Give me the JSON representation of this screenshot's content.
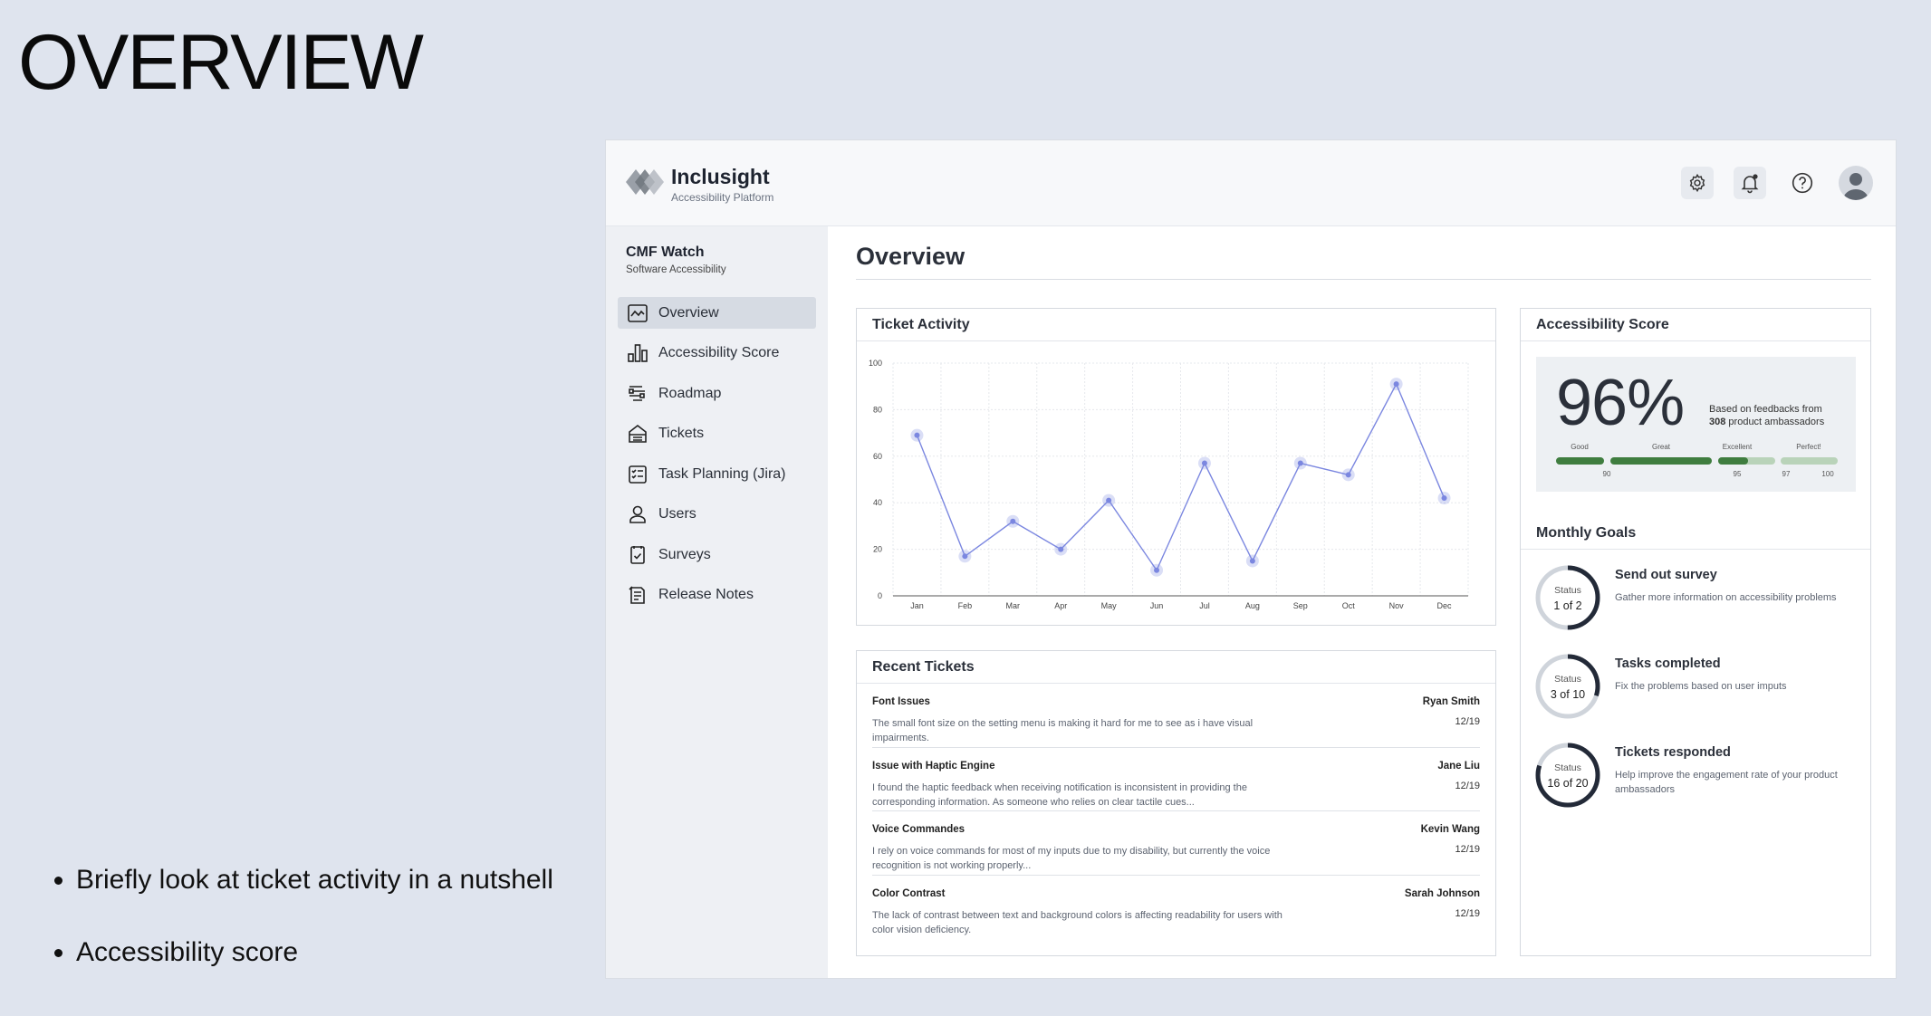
{
  "slide": {
    "title": "OVERVIEW",
    "bullets": [
      "Briefly look at ticket activity in a nutshell",
      "Accessibility score"
    ]
  },
  "app": {
    "brand": "Inclusight",
    "brand_sub": "Accessibility Platform",
    "top_icons": [
      "gear-icon",
      "bell-icon",
      "help-icon",
      "avatar-icon"
    ]
  },
  "sidebar": {
    "project_name": "CMF Watch",
    "project_sub": "Software Accessibility",
    "items": [
      {
        "label": "Overview",
        "icon": "chart-line-icon",
        "active": true
      },
      {
        "label": "Accessibility Score",
        "icon": "bar-chart-icon",
        "active": false
      },
      {
        "label": "Roadmap",
        "icon": "roadmap-icon",
        "active": false
      },
      {
        "label": "Tickets",
        "icon": "ticket-icon",
        "active": false
      },
      {
        "label": "Task Planning (Jira)",
        "icon": "checklist-icon",
        "active": false
      },
      {
        "label": "Users",
        "icon": "user-icon",
        "active": false
      },
      {
        "label": "Surveys",
        "icon": "survey-icon",
        "active": false
      },
      {
        "label": "Release Notes",
        "icon": "notes-icon",
        "active": false
      }
    ]
  },
  "main": {
    "page_title": "Overview",
    "ticket_activity_title": "Ticket Activity",
    "recent_tickets_title": "Recent Tickets",
    "accessibility_score_title": "Accessibility Score",
    "monthly_goals_title": "Monthly Goals"
  },
  "chart_data": {
    "type": "line",
    "categories": [
      "Jan",
      "Feb",
      "Mar",
      "Apr",
      "May",
      "Jun",
      "Jul",
      "Aug",
      "Sep",
      "Oct",
      "Nov",
      "Dec"
    ],
    "series": [
      {
        "values": [
          69,
          17,
          32,
          20,
          41,
          11,
          57,
          15,
          57,
          52,
          91,
          42
        ]
      }
    ],
    "yticks": [
      0,
      20,
      40,
      60,
      80,
      100
    ],
    "ylim": [
      0,
      100
    ],
    "grid": true,
    "color": "#7b87e0"
  },
  "tickets": [
    {
      "title": "Font Issues",
      "desc": "The small font size on the setting menu is making it hard for me to see as i have visual impairments.",
      "user": "Ryan Smith",
      "date": "12/19"
    },
    {
      "title": "Issue with Haptic Engine",
      "desc": "I found the haptic feedback when receiving notification is inconsistent in providing the corresponding information. As someone who relies on clear tactile cues...",
      "user": "Jane Liu",
      "date": "12/19"
    },
    {
      "title": "Voice Commandes",
      "desc": "I rely on voice commands for most of my inputs due to my disability, but currently the voice recognition is not working properly...",
      "user": "Kevin Wang",
      "date": "12/19"
    },
    {
      "title": "Color Contrast",
      "desc": "The lack of contrast between text and background colors is affecting readability for users with color vision deficiency.",
      "user": "Sarah Johnson",
      "date": "12/19"
    }
  ],
  "score": {
    "value": "96%",
    "note_prefix": "Based on feedbacks from",
    "note_count": "308",
    "note_suffix": "product ambassadors",
    "scale_labels": [
      "Good",
      "Great",
      "Excellent",
      "Perfect!"
    ],
    "scale_ticks": [
      "90",
      "95",
      "97",
      "100"
    ],
    "fill_color": "#3f7d3f",
    "track_color": "#b9d3b9"
  },
  "goals": [
    {
      "title": "Send out survey",
      "desc": "Gather more information on accessibility problems",
      "status_label": "Status",
      "status": "1 of 2",
      "progress": 0.5
    },
    {
      "title": "Tasks completed",
      "desc": "Fix the problems based on user imputs",
      "status_label": "Status",
      "status": "3 of 10",
      "progress": 0.3
    },
    {
      "title": "Tickets responded",
      "desc": "Help improve the engagement rate of your product ambassadors",
      "status_label": "Status",
      "status": "16 of 20",
      "progress": 0.8
    }
  ]
}
